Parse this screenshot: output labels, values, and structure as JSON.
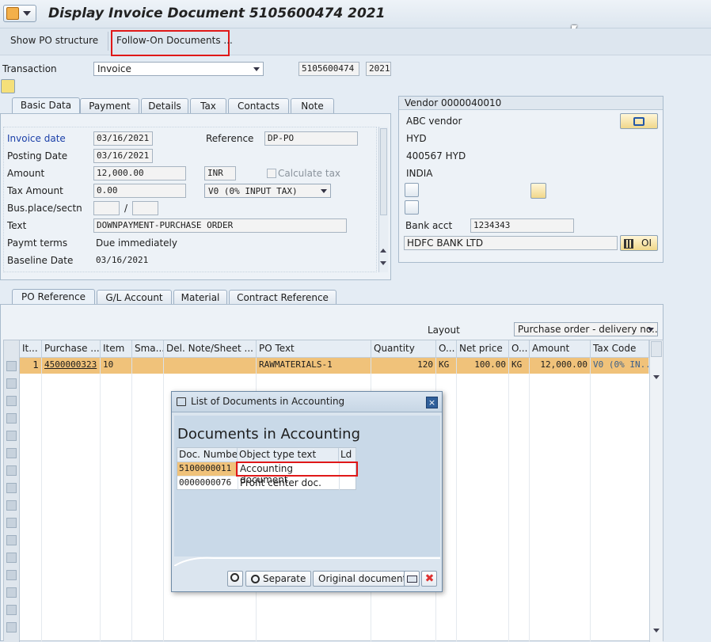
{
  "window": {
    "title": "Display Invoice Document 5105600474 2021"
  },
  "toolbar": {
    "show_po_structure": "Show PO structure",
    "follow_on_documents": "Follow-On Documents ..."
  },
  "transaction": {
    "label": "Transaction",
    "value": "Invoice",
    "doc_number": "5105600474",
    "year": "2021"
  },
  "header_tabs": [
    "Basic Data",
    "Payment",
    "Details",
    "Tax",
    "Contacts",
    "Note"
  ],
  "basic_data": {
    "invoice_date_label": "Invoice date",
    "invoice_date": "03/16/2021",
    "posting_date_label": "Posting Date",
    "posting_date": "03/16/2021",
    "reference_label": "Reference",
    "reference": "DP-PO",
    "amount_label": "Amount",
    "amount": "12,000.00",
    "currency": "INR",
    "calculate_tax_label": "Calculate tax",
    "tax_amount_label": "Tax Amount",
    "tax_amount": "0.00",
    "tax_code": "V0 (0% INPUT TAX)",
    "bus_place_label": "Bus.place/sectn",
    "bus_place_sep": "/",
    "text_label": "Text",
    "text": "DOWNPAYMENT-PURCHASE ORDER",
    "paymt_terms_label": "Paymt terms",
    "paymt_terms": "Due immediately",
    "baseline_date_label": "Baseline Date",
    "baseline_date": "03/16/2021"
  },
  "vendor": {
    "title": "Vendor 0000040010",
    "name": "ABC vendor",
    "city": "HYD",
    "postal": "400567 HYD",
    "country": "INDIA",
    "bank_acct_label": "Bank acct",
    "bank_acct": "1234343",
    "bank_name": "HDFC BANK LTD",
    "oi_label": "OI"
  },
  "item_tabs": [
    "PO Reference",
    "G/L Account",
    "Material",
    "Contract Reference"
  ],
  "layout": {
    "label": "Layout",
    "value": "Purchase order - delivery no..."
  },
  "grid": {
    "headers": [
      "It...",
      "Purchase ...",
      "Item",
      "Sma...",
      "Del. Note/Sheet ...",
      "PO Text",
      "Quantity",
      "O...",
      "Net price",
      "O...",
      "Amount",
      "Tax Code"
    ],
    "row": {
      "it": "1",
      "po": "4500000323",
      "item": "10",
      "sma": "",
      "del": "",
      "text": "RAWMATERIALS-1",
      "qty": "120",
      "uom": "KG",
      "price": "100.00",
      "ouom": "KG",
      "amount": "12,000.00",
      "tax": "V0 (0% IN..."
    }
  },
  "dialog": {
    "title": "List of Documents in Accounting",
    "heading": "Documents in Accounting",
    "columns": [
      "Doc. Number",
      "Object type text",
      "Ld"
    ],
    "rows": [
      {
        "doc": "5100000011",
        "type": "Accounting document",
        "ld": ""
      },
      {
        "doc": "0000000076",
        "type": "Profit center doc.",
        "ld": ""
      }
    ],
    "separate_label": "Separate",
    "original_document_label": "Original document"
  },
  "colors": {
    "highlight_row": "#f0c27a",
    "link": "#1a3fa8",
    "red_box": "#e01818"
  }
}
